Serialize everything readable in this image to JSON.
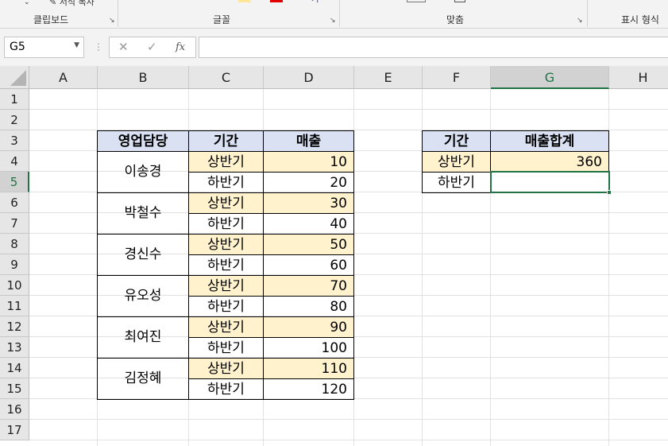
{
  "ribbon": {
    "top_left": "서식 복사",
    "groups": [
      "클립보드",
      "글꼴",
      "맞춤",
      "표시 형식"
    ]
  },
  "formula_bar": {
    "name_box": "G5",
    "cancel_symbol": "✕",
    "enter_symbol": "✓",
    "fx_symbol": "fx",
    "formula": ""
  },
  "columns": [
    "A",
    "B",
    "C",
    "D",
    "E",
    "F",
    "G",
    "H"
  ],
  "rows": [
    "1",
    "2",
    "3",
    "4",
    "5",
    "6",
    "7",
    "8",
    "9",
    "10",
    "11",
    "12",
    "13",
    "14",
    "15",
    "16",
    "17"
  ],
  "selected_cell": {
    "col": "G",
    "row": "5"
  },
  "source_table": {
    "headers": {
      "rep": "영업담당",
      "period": "기간",
      "sales": "매출"
    },
    "reps": [
      "이송경",
      "박철수",
      "경신수",
      "유오성",
      "최여진",
      "김정혜"
    ],
    "rows": [
      {
        "period": "상반기",
        "sales": "10"
      },
      {
        "period": "하반기",
        "sales": "20"
      },
      {
        "period": "상반기",
        "sales": "30"
      },
      {
        "period": "하반기",
        "sales": "40"
      },
      {
        "period": "상반기",
        "sales": "50"
      },
      {
        "period": "하반기",
        "sales": "60"
      },
      {
        "period": "상반기",
        "sales": "70"
      },
      {
        "period": "하반기",
        "sales": "80"
      },
      {
        "period": "상반기",
        "sales": "90"
      },
      {
        "period": "하반기",
        "sales": "100"
      },
      {
        "period": "상반기",
        "sales": "110"
      },
      {
        "period": "하반기",
        "sales": "120"
      }
    ]
  },
  "summary_table": {
    "headers": {
      "period": "기간",
      "total": "매출합계"
    },
    "rows": [
      {
        "period": "상반기",
        "total": "360"
      },
      {
        "period": "하반기",
        "total": ""
      }
    ]
  },
  "colors": {
    "header_fill": "#d9e1f2",
    "highlight_fill": "#fff2cc",
    "selection": "#217346"
  }
}
